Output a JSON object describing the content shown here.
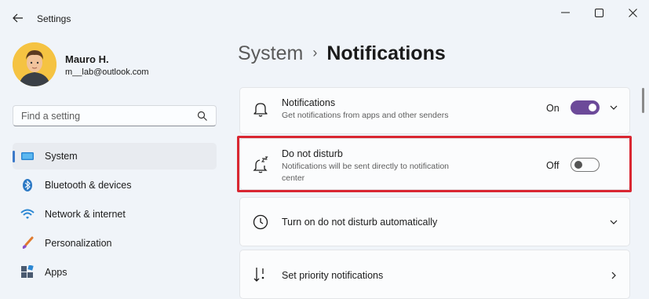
{
  "window": {
    "title": "Settings",
    "controls": [
      "minimize-icon",
      "maximize-icon",
      "close-icon"
    ]
  },
  "user": {
    "name": "Mauro H.",
    "email": "m__lab@outlook.com"
  },
  "search": {
    "placeholder": "Find a setting"
  },
  "sidebar": {
    "items": [
      {
        "label": "System",
        "icon": "monitor-icon",
        "active": true
      },
      {
        "label": "Bluetooth & devices",
        "icon": "bluetooth-icon"
      },
      {
        "label": "Network & internet",
        "icon": "wifi-icon"
      },
      {
        "label": "Personalization",
        "icon": "brush-icon"
      },
      {
        "label": "Apps",
        "icon": "apps-icon"
      }
    ]
  },
  "breadcrumb": {
    "parent": "System",
    "separator": "›",
    "current": "Notifications"
  },
  "settings": [
    {
      "title": "Notifications",
      "description": "Get notifications from apps and other senders",
      "state": "On",
      "icon": "bell-icon"
    },
    {
      "title": "Do not disturb",
      "description_line1": "Notifications will be sent directly to notification",
      "description_line2": "center",
      "state": "Off",
      "icon": "snooze-bell-icon"
    },
    {
      "title": "Turn on do not disturb automatically",
      "icon": "clock-icon"
    },
    {
      "title": "Set priority notifications",
      "icon": "sort-priority-icon"
    }
  ],
  "colors": {
    "accent": "#6c4a99",
    "highlight": "#d92631",
    "active_indicator": "#3b79c9"
  }
}
